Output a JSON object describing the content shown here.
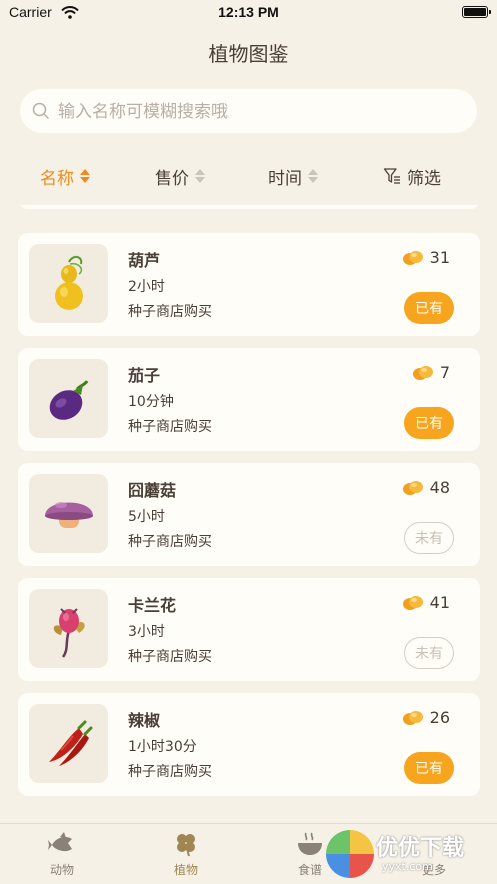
{
  "status": {
    "carrier": "Carrier",
    "time": "12:13 PM"
  },
  "nav": {
    "title": "植物图鉴"
  },
  "search": {
    "placeholder": "输入名称可模糊搜索哦"
  },
  "sort": {
    "name_label": "名称",
    "price_label": "售价",
    "time_label": "时间",
    "filter_label": "筛选",
    "active": "名称"
  },
  "list": [
    {
      "name": "葫芦",
      "time": "2小时",
      "source": "种子商店购买",
      "price": "31",
      "status": "已有",
      "owned": true,
      "icon": "gourd-icon"
    },
    {
      "name": "茄子",
      "time": "10分钟",
      "source": "种子商店购买",
      "price": "7",
      "status": "已有",
      "owned": true,
      "icon": "eggplant-icon"
    },
    {
      "name": "囧蘑菇",
      "time": "5小时",
      "source": "种子商店购买",
      "price": "48",
      "status": "未有",
      "owned": false,
      "icon": "mushroom-icon"
    },
    {
      "name": "卡兰花",
      "time": "3小时",
      "source": "种子商店购买",
      "price": "41",
      "status": "未有",
      "owned": false,
      "icon": "flower-icon"
    },
    {
      "name": "辣椒",
      "time": "1小时30分",
      "source": "种子商店购买",
      "price": "26",
      "status": "已有",
      "owned": true,
      "icon": "chili-icon"
    }
  ],
  "tabs": [
    {
      "label": "动物",
      "icon": "fish-icon"
    },
    {
      "label": "植物",
      "icon": "clover-icon",
      "active": true
    },
    {
      "label": "食谱",
      "icon": "bowl-icon"
    },
    {
      "label": "更多",
      "icon": "more-icon"
    }
  ],
  "watermark": {
    "text": "优优下载",
    "url": "yyxt.com"
  },
  "colors": {
    "accent": "#ef8b1b",
    "owned_badge": "#f7a51e",
    "background": "#f6f1e6",
    "card": "#fffdf8"
  }
}
